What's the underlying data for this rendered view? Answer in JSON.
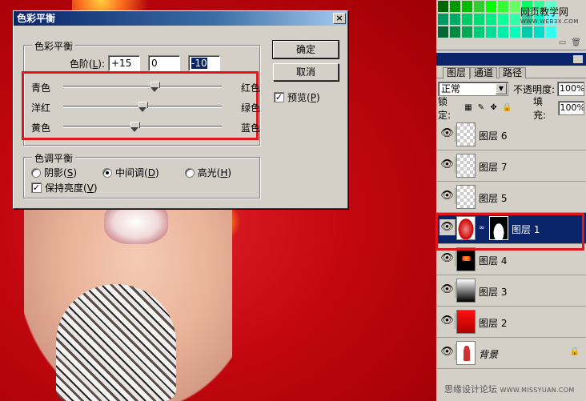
{
  "dialog": {
    "title": "色彩平衡",
    "close_glyph": "×",
    "balance_group": {
      "legend": "色彩平衡",
      "levels_label_prefix": "色阶(",
      "levels_label_key": "L",
      "levels_label_suffix": "):",
      "levels": [
        "+15",
        "0",
        "-10"
      ]
    },
    "sliders": [
      {
        "left": "青色",
        "right": "红色",
        "value": 15
      },
      {
        "left": "洋红",
        "right": "绿色",
        "value": 0
      },
      {
        "left": "黄色",
        "right": "蓝色",
        "value": -10
      }
    ],
    "tone_group": {
      "legend": "色调平衡",
      "options": [
        {
          "label": "阴影(",
          "key": "S",
          "suffix": ")",
          "selected": false
        },
        {
          "label": "中间调(",
          "key": "D",
          "suffix": ")",
          "selected": true
        },
        {
          "label": "高光(",
          "key": "H",
          "suffix": ")",
          "selected": false
        }
      ],
      "preserve": {
        "label": "保持亮度(",
        "key": "V",
        "suffix": ")",
        "checked": true
      }
    },
    "ok_label": "确定",
    "cancel_label": "取消",
    "preview": {
      "label": "预览(",
      "key": "P",
      "suffix": ")",
      "checked": true
    }
  },
  "swatches": {
    "watermark": "网页教学网",
    "watermark_site": "WWW.WEB3X.COM",
    "colors": [
      "#006600",
      "#009900",
      "#00bb00",
      "#33cc33",
      "#00ff00",
      "#33ff33",
      "#66ff66",
      "#00ff66",
      "#33ff99",
      "#66ffcc",
      "#009966",
      "#00aa66",
      "#00cc66",
      "#00dd77",
      "#00ee88",
      "#11ff99",
      "#33ffaa",
      "#33cc99",
      "#00ffcc",
      "#66ffff",
      "#006633",
      "#008844",
      "#00aa55",
      "#00cc77",
      "#00dd99",
      "#00eeaa",
      "#00ffbb",
      "#00ccaa",
      "#00ddcc",
      "#33ffee"
    ],
    "icons": [
      "new-swatch-icon",
      "trash-icon"
    ]
  },
  "layers": {
    "tabs": [
      {
        "label": "图层",
        "active": true
      },
      {
        "label": "通道",
        "active": false
      },
      {
        "label": "路径",
        "active": false
      }
    ],
    "blend_mode": "正常",
    "opacity_label": "不透明度:",
    "opacity_value": "100%",
    "lock_label": "锁定:",
    "fill_label": "填充:",
    "fill_value": "100%",
    "items": [
      {
        "name": "图层 6",
        "thumb": "transparent",
        "selected": false
      },
      {
        "name": "图层 7",
        "thumb": "transparent",
        "selected": false
      },
      {
        "name": "图层 5",
        "thumb": "transparent",
        "selected": false
      },
      {
        "name": "图层 1",
        "thumb": "photo",
        "selected": true,
        "mask": true
      },
      {
        "name": "图层 4",
        "thumb": "fire",
        "selected": false
      },
      {
        "name": "图层 3",
        "thumb": "gradient",
        "selected": false
      },
      {
        "name": "图层 2",
        "thumb": "red",
        "selected": false
      },
      {
        "name": "背景",
        "thumb": "background",
        "selected": false,
        "locked": true
      }
    ]
  },
  "footer": {
    "watermark": "思缘设计论坛",
    "watermark_site": "WWW.MISSYUAN.COM"
  }
}
